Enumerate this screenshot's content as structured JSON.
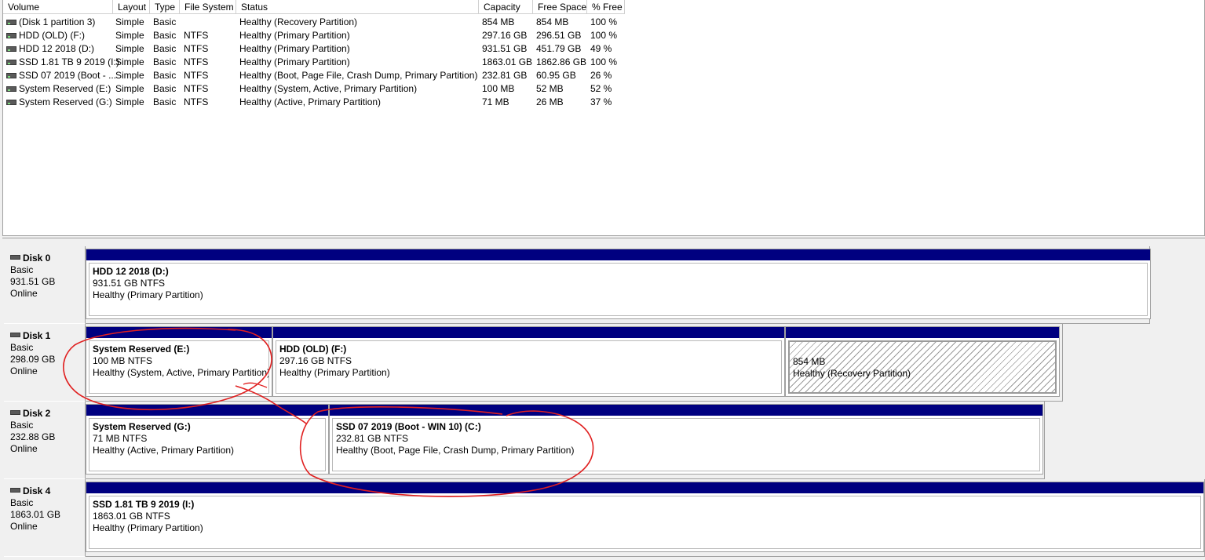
{
  "columns": [
    "Volume",
    "Layout",
    "Type",
    "File System",
    "Status",
    "Capacity",
    "Free Space",
    "% Free"
  ],
  "volumes": [
    [
      "(Disk 1 partition 3)",
      "Simple",
      "Basic",
      "",
      "Healthy (Recovery Partition)",
      "854 MB",
      "854 MB",
      "100 %"
    ],
    [
      "HDD (OLD) (F:)",
      "Simple",
      "Basic",
      "NTFS",
      "Healthy (Primary Partition)",
      "297.16 GB",
      "296.51 GB",
      "100 %"
    ],
    [
      "HDD 12 2018 (D:)",
      "Simple",
      "Basic",
      "NTFS",
      "Healthy (Primary Partition)",
      "931.51 GB",
      "451.79 GB",
      "49 %"
    ],
    [
      "SSD 1.81 TB 9 2019 (I:)",
      "Simple",
      "Basic",
      "NTFS",
      "Healthy (Primary Partition)",
      "1863.01 GB",
      "1862.86 GB",
      "100 %"
    ],
    [
      "SSD 07 2019 (Boot - ...",
      "Simple",
      "Basic",
      "NTFS",
      "Healthy (Boot, Page File, Crash Dump, Primary Partition)",
      "232.81 GB",
      "60.95 GB",
      "26 %"
    ],
    [
      "System Reserved (E:)",
      "Simple",
      "Basic",
      "NTFS",
      "Healthy (System, Active, Primary Partition)",
      "100 MB",
      "52 MB",
      "52 %"
    ],
    [
      "System Reserved (G:)",
      "Simple",
      "Basic",
      "NTFS",
      "Healthy (Active, Primary Partition)",
      "71 MB",
      "26 MB",
      "37 %"
    ]
  ],
  "disks": [
    {
      "name": "Disk 0",
      "type": "Basic",
      "size": "931.51 GB",
      "state": "Online",
      "partitions": [
        {
          "name": "HDD 12 2018  (D:)",
          "size": "931.51 GB NTFS",
          "status": "Healthy (Primary Partition)",
          "hatched": false
        }
      ]
    },
    {
      "name": "Disk 1",
      "type": "Basic",
      "size": "298.09 GB",
      "state": "Online",
      "partitions": [
        {
          "name": "System Reserved  (E:)",
          "size": "100 MB NTFS",
          "status": "Healthy (System, Active, Primary Partition)",
          "hatched": false
        },
        {
          "name": "HDD (OLD)  (F:)",
          "size": "297.16 GB NTFS",
          "status": "Healthy (Primary Partition)",
          "hatched": false
        },
        {
          "name": "",
          "size": "854 MB",
          "status": "Healthy (Recovery Partition)",
          "hatched": true
        }
      ]
    },
    {
      "name": "Disk 2",
      "type": "Basic",
      "size": "232.88 GB",
      "state": "Online",
      "partitions": [
        {
          "name": "System Reserved  (G:)",
          "size": "71 MB NTFS",
          "status": "Healthy (Active, Primary Partition)",
          "hatched": false
        },
        {
          "name": "SSD 07 2019 (Boot - WIN 10)  (C:)",
          "size": "232.81 GB NTFS",
          "status": "Healthy (Boot, Page File, Crash Dump, Primary Partition)",
          "hatched": false
        }
      ]
    },
    {
      "name": "Disk 4",
      "type": "Basic",
      "size": "1863.01 GB",
      "state": "Online",
      "partitions": [
        {
          "name": "SSD 1.81 TB 9 2019  (I:)",
          "size": "1863.01 GB NTFS",
          "status": "Healthy (Primary Partition)",
          "hatched": false
        }
      ]
    }
  ],
  "colors": {
    "partition_bar": "#000080",
    "annotation": "#e02020"
  },
  "icons": [
    "drive-icon",
    "disk-icon"
  ]
}
